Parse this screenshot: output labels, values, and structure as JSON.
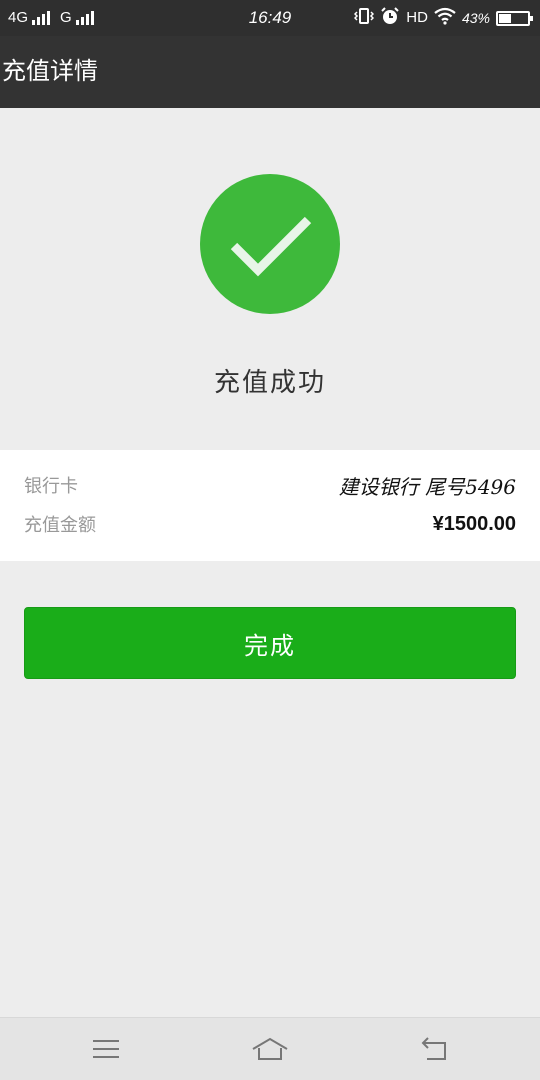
{
  "status_bar": {
    "network_1": "4G",
    "network_2": "G",
    "time": "16:49",
    "hd": "HD",
    "battery": "43%",
    "icons": [
      "vibrate-icon",
      "alarm-icon",
      "wifi-icon",
      "battery-icon"
    ]
  },
  "header": {
    "title": "充值详情"
  },
  "success": {
    "title": "充值成功",
    "icon": "check-circle-icon",
    "color": "#3eb93b"
  },
  "details": {
    "bank_label": "银行卡",
    "bank_value": "建设银行 尾号5496",
    "amount_label": "充值金额",
    "amount_value": "¥1500.00"
  },
  "actions": {
    "done_label": "完成",
    "done_color": "#1aad19"
  },
  "nav": {
    "icons": [
      "menu-icon",
      "home-icon",
      "back-icon"
    ]
  }
}
